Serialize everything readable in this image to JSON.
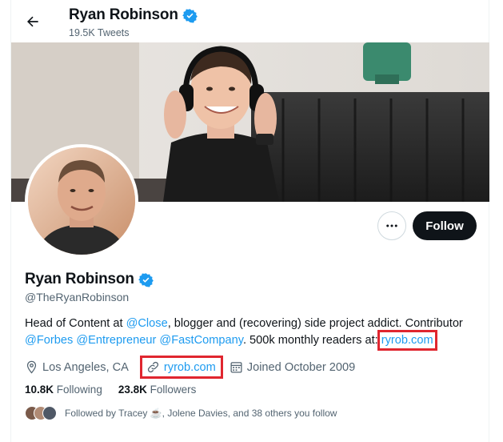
{
  "header": {
    "name": "Ryan Robinson",
    "tweet_count": "19.5K Tweets"
  },
  "profile": {
    "name": "Ryan Robinson",
    "handle": "@TheRyanRobinson",
    "follow_label": "Follow",
    "bio": {
      "p1": "Head of Content at ",
      "m_close": "@Close",
      "p2": ", blogger and (recovering) side project addict. Contributor ",
      "m_forbes": "@Forbes",
      "m_entre": "@Entrepreneur",
      "m_fast": "@FastCompany",
      "p3": ". 500k monthly readers at: ",
      "link": "ryrob.com"
    },
    "location": "Los Angeles, CA",
    "website": "ryrob.com",
    "joined": "Joined October 2009",
    "following_count": "10.8K",
    "following_label": "Following",
    "followers_count": "23.8K",
    "followers_label": "Followers",
    "followed_by": "Followed by Tracey ☕, Jolene Davies, and 38 others you follow"
  },
  "colors": {
    "accent": "#1d9bf0",
    "highlight": "#e0262f",
    "verified": "#1d9bf0"
  }
}
